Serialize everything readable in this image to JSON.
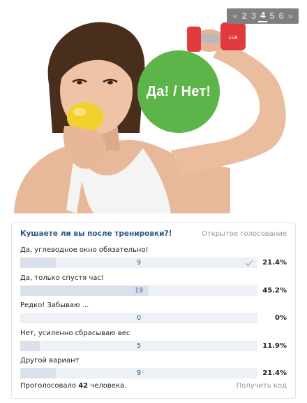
{
  "pager": {
    "prev": "«",
    "pages": [
      "2",
      "3",
      "4",
      "5",
      "6"
    ],
    "current": "4",
    "next": "»"
  },
  "banner": {
    "circle_text": "Да! / Нет!",
    "circle_color": "#5db54a",
    "dumbbell_label": "1LB",
    "dumbbell_color": "#e23a3c",
    "lemon_color": "#f2d02e"
  },
  "poll": {
    "question": "Кушаете ли вы после тренировки?!",
    "type": "Открытое голосование",
    "answers": [
      {
        "text": "Да, углеводное окно обязательно!",
        "count": "9",
        "percent": "21.4%",
        "share": 0.214,
        "voted": true
      },
      {
        "text": "Да, только спустя час!",
        "count": "19",
        "percent": "45.2%",
        "share": 0.452,
        "voted": false
      },
      {
        "text": "Редко! Забываю ...",
        "count": "0",
        "percent": "0%",
        "share": 0,
        "voted": false
      },
      {
        "text": "Нет, усиленно сбрасываю вес",
        "count": "5",
        "percent": "11.9%",
        "share": 0.119,
        "voted": false
      },
      {
        "text": "Другой вариант",
        "count": "9",
        "percent": "21.4%",
        "share": 0.214,
        "voted": false
      }
    ],
    "voted_prefix": "Проголосовало",
    "voted_count": "42",
    "voted_suffix": "человека.",
    "get_code": "Получить код"
  }
}
